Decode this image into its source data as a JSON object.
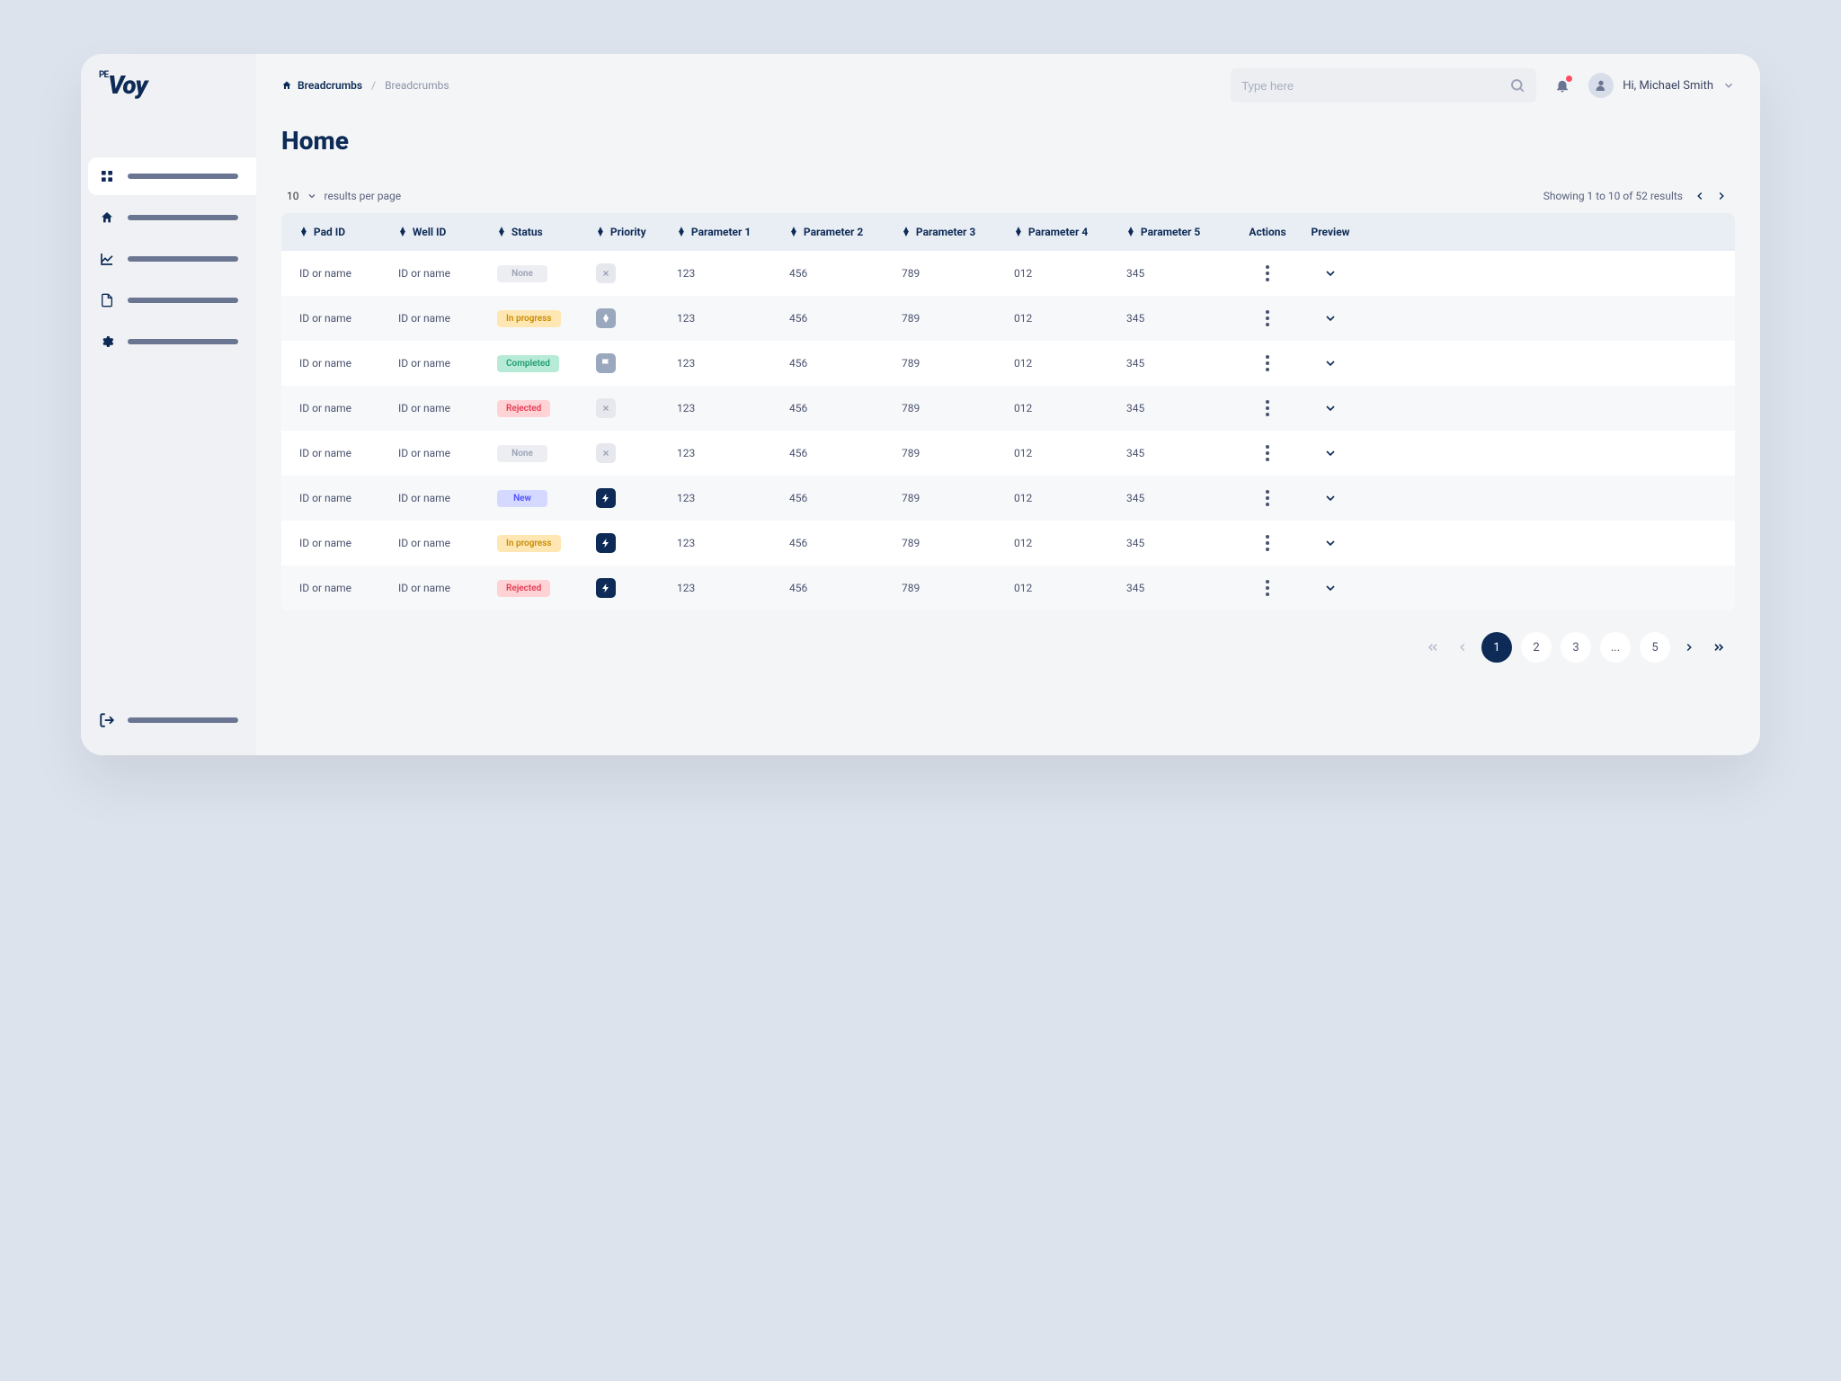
{
  "logo": {
    "prefix": "PE",
    "text": "Voy"
  },
  "sidebar": {
    "items": [
      {
        "icon": "grid-icon",
        "active": true
      },
      {
        "icon": "home-icon",
        "active": false
      },
      {
        "icon": "chart-icon",
        "active": false
      },
      {
        "icon": "document-icon",
        "active": false
      },
      {
        "icon": "gear-icon",
        "active": false
      }
    ],
    "footer_icon": "logout-icon"
  },
  "breadcrumbs": {
    "home_icon": "home-icon",
    "items": [
      "Breadcrumbs",
      "Breadcrumbs"
    ]
  },
  "search": {
    "placeholder": "Type here"
  },
  "user": {
    "greeting": "Hi, Michael Smith"
  },
  "page_title": "Home",
  "table": {
    "per_page_value": "10",
    "per_page_label": "results per page",
    "results_info": "Showing 1 to 10 of 52 results",
    "columns": [
      "Pad ID",
      "Well ID",
      "Status",
      "Priority",
      "Parameter 1",
      "Parameter 2",
      "Parameter 3",
      "Parameter 4",
      "Parameter 5",
      "Actions",
      "Preview"
    ],
    "rows": [
      {
        "pad": "ID or name",
        "well": "ID or name",
        "status": "None",
        "status_class": "none",
        "priority": "none",
        "p1": "123",
        "p2": "456",
        "p3": "789",
        "p4": "012",
        "p5": "345"
      },
      {
        "pad": "ID or name",
        "well": "ID or name",
        "status": "In progress",
        "status_class": "inprogress",
        "priority": "diamond",
        "p1": "123",
        "p2": "456",
        "p3": "789",
        "p4": "012",
        "p5": "345"
      },
      {
        "pad": "ID or name",
        "well": "ID or name",
        "status": "Completed",
        "status_class": "completed",
        "priority": "flag",
        "p1": "123",
        "p2": "456",
        "p3": "789",
        "p4": "012",
        "p5": "345"
      },
      {
        "pad": "ID or name",
        "well": "ID or name",
        "status": "Rejected",
        "status_class": "rejected",
        "priority": "none",
        "p1": "123",
        "p2": "456",
        "p3": "789",
        "p4": "012",
        "p5": "345"
      },
      {
        "pad": "ID or name",
        "well": "ID or name",
        "status": "None",
        "status_class": "none",
        "priority": "none",
        "p1": "123",
        "p2": "456",
        "p3": "789",
        "p4": "012",
        "p5": "345"
      },
      {
        "pad": "ID or name",
        "well": "ID or name",
        "status": "New",
        "status_class": "new",
        "priority": "bolt",
        "p1": "123",
        "p2": "456",
        "p3": "789",
        "p4": "012",
        "p5": "345"
      },
      {
        "pad": "ID or name",
        "well": "ID or name",
        "status": "In progress",
        "status_class": "inprogress",
        "priority": "bolt",
        "p1": "123",
        "p2": "456",
        "p3": "789",
        "p4": "012",
        "p5": "345"
      },
      {
        "pad": "ID or name",
        "well": "ID or name",
        "status": "Rejected",
        "status_class": "rejected",
        "priority": "bolt",
        "p1": "123",
        "p2": "456",
        "p3": "789",
        "p4": "012",
        "p5": "345"
      }
    ]
  },
  "pagination": {
    "pages": [
      "1",
      "2",
      "3",
      "...",
      "5"
    ],
    "active": "1"
  }
}
